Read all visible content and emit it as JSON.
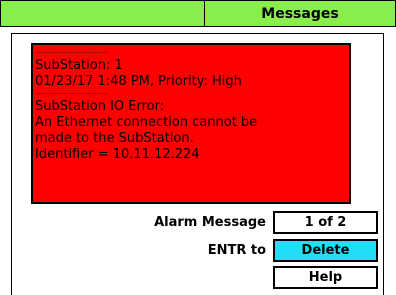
{
  "header": {
    "title": "Messages"
  },
  "alarm": {
    "separator_1": "----------------------------------------",
    "line_1": "SubStation: 1",
    "line_2": "01/23/17 1:48 PM, Priority: High",
    "separator_2": "----------------------------------------",
    "line_3": "SubStation IO Error:",
    "line_4": "An Ethernet connection cannot be",
    "line_5": "made to the SubStation.",
    "line_6": "Identifier = 10.11.12.224"
  },
  "controls": {
    "alarm_message_label": "Alarm Message",
    "alarm_message_value": "1 of 2",
    "entr_label": "ENTR to",
    "delete_label": "Delete",
    "help_label": "Help"
  },
  "colors": {
    "header_bg": "#88ee4c",
    "alarm_bg": "#ff0000",
    "delete_bg": "#22ddf5"
  }
}
